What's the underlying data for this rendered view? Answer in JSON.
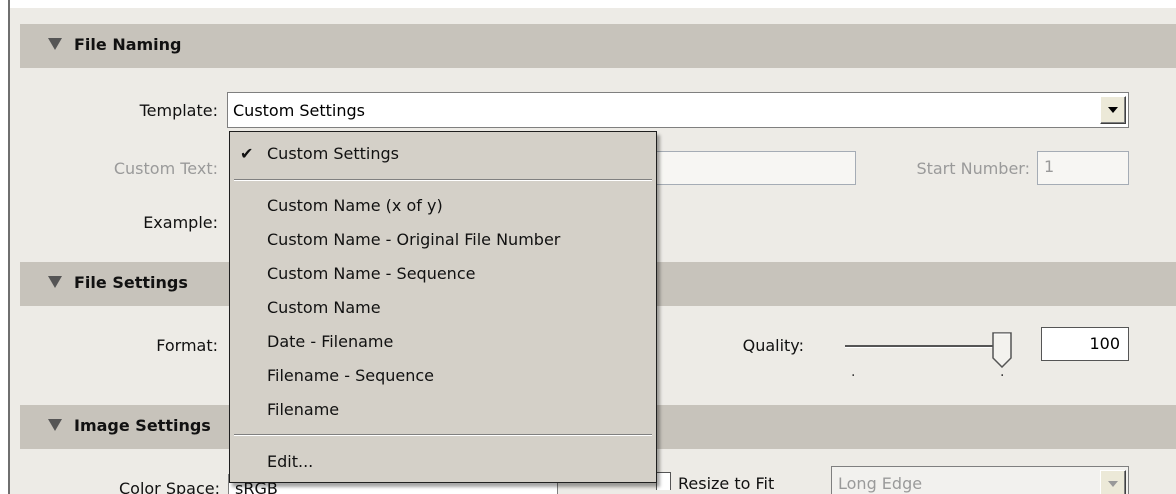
{
  "sections": {
    "file_naming": "File Naming",
    "file_settings": "File Settings",
    "image_settings": "Image Settings"
  },
  "file_naming": {
    "template_label": "Template:",
    "template_value": "Custom Settings",
    "custom_text_label": "Custom Text:",
    "custom_text_value": "",
    "start_number_label": "Start Number:",
    "start_number_value": "1",
    "example_label": "Example:"
  },
  "file_settings": {
    "format_label": "Format:",
    "quality_label": "Quality:",
    "quality_value": "100",
    "quality_level": 1.0
  },
  "image_settings": {
    "color_space_label": "Color Space:",
    "color_space_value": "sRGB",
    "resize_label": "Resize to Fit",
    "resize_checked": false,
    "resize_mode": "Long Edge"
  },
  "template_menu": {
    "items": [
      {
        "label": "Custom Settings",
        "checked": true
      },
      {
        "label": "Custom Name (x of y)"
      },
      {
        "label": "Custom Name - Original File Number"
      },
      {
        "label": "Custom Name - Sequence"
      },
      {
        "label": "Custom Name"
      },
      {
        "label": "Date - Filename"
      },
      {
        "label": "Filename - Sequence"
      },
      {
        "label": "Filename"
      },
      {
        "label": "Edit..."
      }
    ],
    "check_glyph": "✔"
  }
}
